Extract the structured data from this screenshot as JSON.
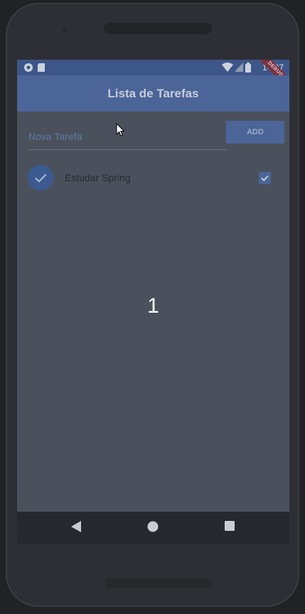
{
  "statusbar": {
    "time": "14:07",
    "debug_label": "DEBUG",
    "icons": [
      "settings-icon",
      "sd-card-icon",
      "wifi-icon",
      "signal-icon",
      "battery-icon"
    ]
  },
  "appbar": {
    "title": "Lista de Tarefas"
  },
  "new_task": {
    "placeholder": "Nova Tarefa",
    "value": "",
    "add_label": "ADD"
  },
  "tasks": [
    {
      "label": "Estudar Spring",
      "done": true
    }
  ],
  "overlay": {
    "number": "1"
  },
  "navbar": {
    "icons": [
      "back-icon",
      "home-icon",
      "recents-icon"
    ]
  },
  "colors": {
    "primary": "#4b6598",
    "statusbar": "#3d5689",
    "screen_bg": "#4b515c",
    "ribbon": "#7a3441"
  }
}
